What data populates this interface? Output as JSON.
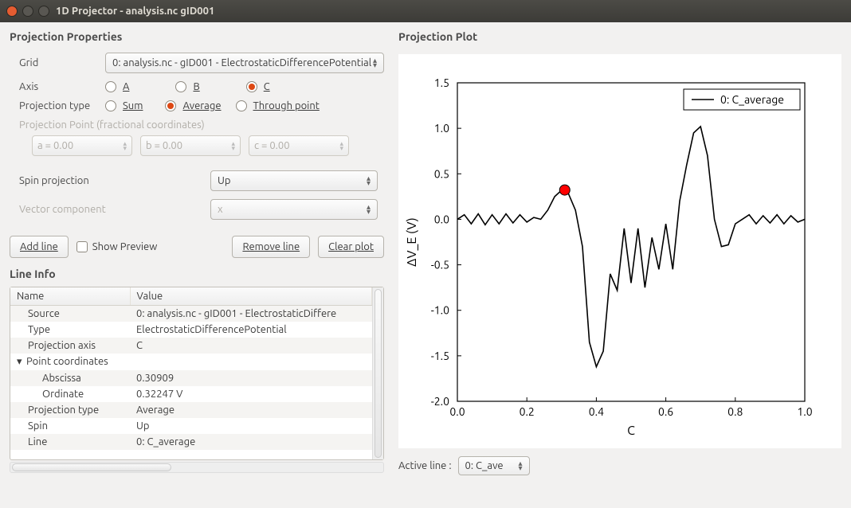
{
  "window": {
    "title": "1D Projector - analysis.nc gID001"
  },
  "left": {
    "heading": "Projection Properties",
    "grid_label": "Grid",
    "grid_value": "0: analysis.nc - gID001 - ElectrostaticDifferencePotential",
    "axis_label": "Axis",
    "axis_options": {
      "a": "A",
      "b": "B",
      "c": "C"
    },
    "projtype_label": "Projection type",
    "projtype_options": {
      "sum": "Sum",
      "avg": "Average",
      "through": "Through point"
    },
    "projpoint_label": "Projection Point (fractional coordinates)",
    "projpoint_a": "a = 0.00",
    "projpoint_b": "b = 0.00",
    "projpoint_c": "c = 0.00",
    "spin_label": "Spin projection",
    "spin_value": "Up",
    "vect_label": "Vector component",
    "vect_value": "x",
    "btn_add": "Add line",
    "chk_preview": "Show Preview",
    "btn_remove": "Remove line",
    "btn_clear": "Clear plot",
    "lineinfo_heading": "Line Info",
    "table": {
      "head_name": "Name",
      "head_value": "Value",
      "rows": {
        "source_k": "Source",
        "source_v": "0: analysis.nc - gID001 - ElectrostaticDiffere",
        "type_k": "Type",
        "type_v": "ElectrostaticDifferencePotential",
        "axis_k": "Projection axis",
        "axis_v": "C",
        "pc_k": "Point coordinates",
        "abs_k": "Abscissa",
        "abs_v": "0.30909",
        "ord_k": "Ordinate",
        "ord_v": "0.32247 V",
        "ptype_k": "Projection type",
        "ptype_v": "Average",
        "spin_k": "Spin",
        "spin_v": "Up",
        "line_k": "Line",
        "line_v": "0: C_average"
      }
    }
  },
  "right": {
    "heading": "Projection Plot",
    "active_label": "Active line :",
    "active_value": "0: C_ave"
  },
  "chart_data": {
    "type": "line",
    "title": "",
    "xlabel": "C",
    "ylabel": "ΔV_E (V)",
    "xlim": [
      0.0,
      1.0
    ],
    "ylim": [
      -2.0,
      1.5
    ],
    "xticks": [
      0.0,
      0.2,
      0.4,
      0.6,
      0.8,
      1.0
    ],
    "yticks": [
      -2.0,
      -1.5,
      -1.0,
      -0.5,
      0.0,
      0.5,
      1.0,
      1.5
    ],
    "legend": [
      "0: C_average"
    ],
    "marker": {
      "x": 0.30909,
      "y": 0.32247,
      "color": "#ff0000"
    },
    "series": [
      {
        "name": "0: C_average",
        "x": [
          0.0,
          0.02,
          0.04,
          0.06,
          0.08,
          0.1,
          0.12,
          0.14,
          0.16,
          0.18,
          0.2,
          0.22,
          0.24,
          0.26,
          0.28,
          0.3,
          0.309,
          0.32,
          0.34,
          0.36,
          0.38,
          0.4,
          0.42,
          0.44,
          0.46,
          0.48,
          0.5,
          0.52,
          0.54,
          0.56,
          0.58,
          0.6,
          0.62,
          0.64,
          0.66,
          0.68,
          0.7,
          0.72,
          0.74,
          0.76,
          0.78,
          0.8,
          0.82,
          0.84,
          0.86,
          0.88,
          0.9,
          0.92,
          0.94,
          0.96,
          0.98,
          1.0
        ],
        "y": [
          0.0,
          0.05,
          -0.05,
          0.06,
          -0.06,
          0.05,
          -0.05,
          0.06,
          -0.04,
          0.05,
          -0.03,
          0.02,
          0.0,
          0.1,
          0.25,
          0.32,
          0.322,
          0.28,
          0.1,
          -0.3,
          -1.35,
          -1.62,
          -1.45,
          -0.6,
          -0.78,
          -0.1,
          -0.7,
          -0.1,
          -0.75,
          -0.2,
          -0.55,
          -0.05,
          -0.55,
          0.2,
          0.6,
          0.95,
          1.02,
          0.7,
          0.0,
          -0.3,
          -0.28,
          -0.05,
          0.0,
          0.05,
          -0.05,
          0.04,
          -0.04,
          0.05,
          -0.05,
          0.04,
          -0.03,
          0.0
        ]
      }
    ]
  }
}
